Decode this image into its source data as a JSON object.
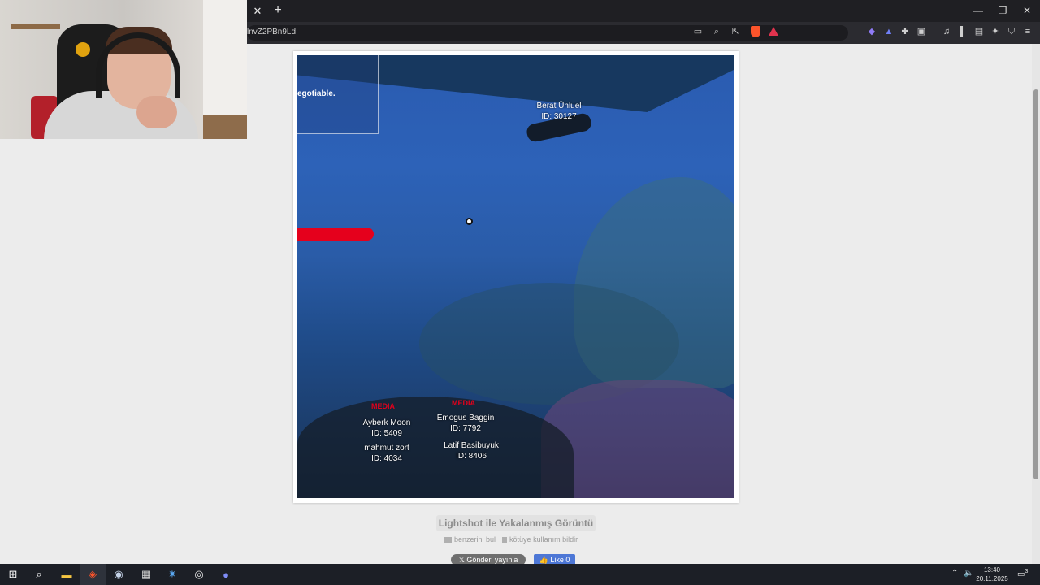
{
  "browser": {
    "tab_close": "✕",
    "new_tab": "+",
    "window_controls": {
      "minimize": "—",
      "restore": "❐",
      "close": "✕"
    },
    "url": "lnvZ2PBn9Ld",
    "toolbar_icons": [
      "cast-icon",
      "zoom-icon",
      "share-icon",
      "brave-shield-icon",
      "brave-rewards-icon",
      "leo-icon",
      "vpn-icon",
      "extensions-icon",
      "screenshot-icon",
      "media-icon",
      "sidebar-icon",
      "wallet-icon",
      "ai-icon",
      "shield-icon",
      "menu-icon"
    ]
  },
  "screenshot": {
    "panel_text": "egotiable.",
    "player_top": {
      "name": "Berat Ünluel",
      "id": "ID: 30127"
    },
    "media_labels": [
      "MEDIA",
      "MEDIA"
    ],
    "player_1": {
      "name": "Ayberk Moon",
      "id": "ID: 5409"
    },
    "player_2": {
      "name": "mahmut zort",
      "id": "ID: 4034"
    },
    "player_3": {
      "name": "Emogus Baggin",
      "id": "ID: 7792"
    },
    "player_4": {
      "name": "Latif Basibuyuk",
      "id": "ID: 8406"
    }
  },
  "page": {
    "caption": "Lightshot ile Yakalanmış Görüntü",
    "find_similar": "benzerini bul",
    "report_abuse": "kötüye kullanım bildir",
    "tweet_button": "𝕏  Gönderi yayınla",
    "like_button": "👍 Like 0"
  },
  "taskbar": {
    "time": "13:40",
    "date": "20.11.2025",
    "notification_count": "3",
    "apps": [
      "start-icon",
      "search-icon",
      "file-explorer-icon",
      "brave-icon",
      "steam-icon",
      "app-icon",
      "battle-net-icon",
      "obs-icon",
      "discord-icon"
    ]
  }
}
